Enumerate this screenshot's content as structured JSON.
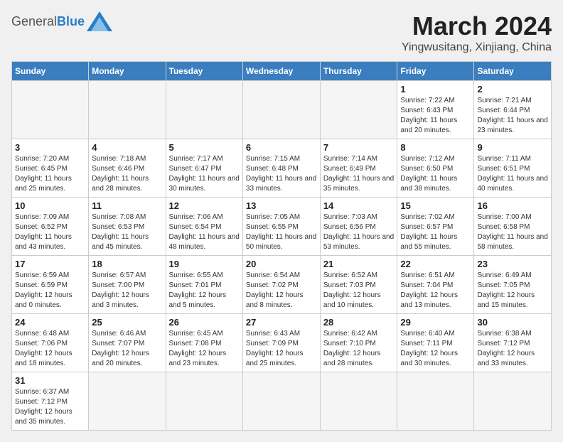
{
  "header": {
    "logo_general": "General",
    "logo_blue": "Blue",
    "month_title": "March 2024",
    "location": "Yingwusitang, Xinjiang, China"
  },
  "days_of_week": [
    "Sunday",
    "Monday",
    "Tuesday",
    "Wednesday",
    "Thursday",
    "Friday",
    "Saturday"
  ],
  "weeks": [
    [
      {
        "day": "",
        "info": ""
      },
      {
        "day": "",
        "info": ""
      },
      {
        "day": "",
        "info": ""
      },
      {
        "day": "",
        "info": ""
      },
      {
        "day": "",
        "info": ""
      },
      {
        "day": "1",
        "info": "Sunrise: 7:22 AM\nSunset: 6:43 PM\nDaylight: 11 hours and 20 minutes."
      },
      {
        "day": "2",
        "info": "Sunrise: 7:21 AM\nSunset: 6:44 PM\nDaylight: 11 hours and 23 minutes."
      }
    ],
    [
      {
        "day": "3",
        "info": "Sunrise: 7:20 AM\nSunset: 6:45 PM\nDaylight: 11 hours and 25 minutes."
      },
      {
        "day": "4",
        "info": "Sunrise: 7:18 AM\nSunset: 6:46 PM\nDaylight: 11 hours and 28 minutes."
      },
      {
        "day": "5",
        "info": "Sunrise: 7:17 AM\nSunset: 6:47 PM\nDaylight: 11 hours and 30 minutes."
      },
      {
        "day": "6",
        "info": "Sunrise: 7:15 AM\nSunset: 6:48 PM\nDaylight: 11 hours and 33 minutes."
      },
      {
        "day": "7",
        "info": "Sunrise: 7:14 AM\nSunset: 6:49 PM\nDaylight: 11 hours and 35 minutes."
      },
      {
        "day": "8",
        "info": "Sunrise: 7:12 AM\nSunset: 6:50 PM\nDaylight: 11 hours and 38 minutes."
      },
      {
        "day": "9",
        "info": "Sunrise: 7:11 AM\nSunset: 6:51 PM\nDaylight: 11 hours and 40 minutes."
      }
    ],
    [
      {
        "day": "10",
        "info": "Sunrise: 7:09 AM\nSunset: 6:52 PM\nDaylight: 11 hours and 43 minutes."
      },
      {
        "day": "11",
        "info": "Sunrise: 7:08 AM\nSunset: 6:53 PM\nDaylight: 11 hours and 45 minutes."
      },
      {
        "day": "12",
        "info": "Sunrise: 7:06 AM\nSunset: 6:54 PM\nDaylight: 11 hours and 48 minutes."
      },
      {
        "day": "13",
        "info": "Sunrise: 7:05 AM\nSunset: 6:55 PM\nDaylight: 11 hours and 50 minutes."
      },
      {
        "day": "14",
        "info": "Sunrise: 7:03 AM\nSunset: 6:56 PM\nDaylight: 11 hours and 53 minutes."
      },
      {
        "day": "15",
        "info": "Sunrise: 7:02 AM\nSunset: 6:57 PM\nDaylight: 11 hours and 55 minutes."
      },
      {
        "day": "16",
        "info": "Sunrise: 7:00 AM\nSunset: 6:58 PM\nDaylight: 11 hours and 58 minutes."
      }
    ],
    [
      {
        "day": "17",
        "info": "Sunrise: 6:59 AM\nSunset: 6:59 PM\nDaylight: 12 hours and 0 minutes."
      },
      {
        "day": "18",
        "info": "Sunrise: 6:57 AM\nSunset: 7:00 PM\nDaylight: 12 hours and 3 minutes."
      },
      {
        "day": "19",
        "info": "Sunrise: 6:55 AM\nSunset: 7:01 PM\nDaylight: 12 hours and 5 minutes."
      },
      {
        "day": "20",
        "info": "Sunrise: 6:54 AM\nSunset: 7:02 PM\nDaylight: 12 hours and 8 minutes."
      },
      {
        "day": "21",
        "info": "Sunrise: 6:52 AM\nSunset: 7:03 PM\nDaylight: 12 hours and 10 minutes."
      },
      {
        "day": "22",
        "info": "Sunrise: 6:51 AM\nSunset: 7:04 PM\nDaylight: 12 hours and 13 minutes."
      },
      {
        "day": "23",
        "info": "Sunrise: 6:49 AM\nSunset: 7:05 PM\nDaylight: 12 hours and 15 minutes."
      }
    ],
    [
      {
        "day": "24",
        "info": "Sunrise: 6:48 AM\nSunset: 7:06 PM\nDaylight: 12 hours and 18 minutes."
      },
      {
        "day": "25",
        "info": "Sunrise: 6:46 AM\nSunset: 7:07 PM\nDaylight: 12 hours and 20 minutes."
      },
      {
        "day": "26",
        "info": "Sunrise: 6:45 AM\nSunset: 7:08 PM\nDaylight: 12 hours and 23 minutes."
      },
      {
        "day": "27",
        "info": "Sunrise: 6:43 AM\nSunset: 7:09 PM\nDaylight: 12 hours and 25 minutes."
      },
      {
        "day": "28",
        "info": "Sunrise: 6:42 AM\nSunset: 7:10 PM\nDaylight: 12 hours and 28 minutes."
      },
      {
        "day": "29",
        "info": "Sunrise: 6:40 AM\nSunset: 7:11 PM\nDaylight: 12 hours and 30 minutes."
      },
      {
        "day": "30",
        "info": "Sunrise: 6:38 AM\nSunset: 7:12 PM\nDaylight: 12 hours and 33 minutes."
      }
    ],
    [
      {
        "day": "31",
        "info": "Sunrise: 6:37 AM\nSunset: 7:12 PM\nDaylight: 12 hours and 35 minutes."
      },
      {
        "day": "",
        "info": ""
      },
      {
        "day": "",
        "info": ""
      },
      {
        "day": "",
        "info": ""
      },
      {
        "day": "",
        "info": ""
      },
      {
        "day": "",
        "info": ""
      },
      {
        "day": "",
        "info": ""
      }
    ]
  ]
}
